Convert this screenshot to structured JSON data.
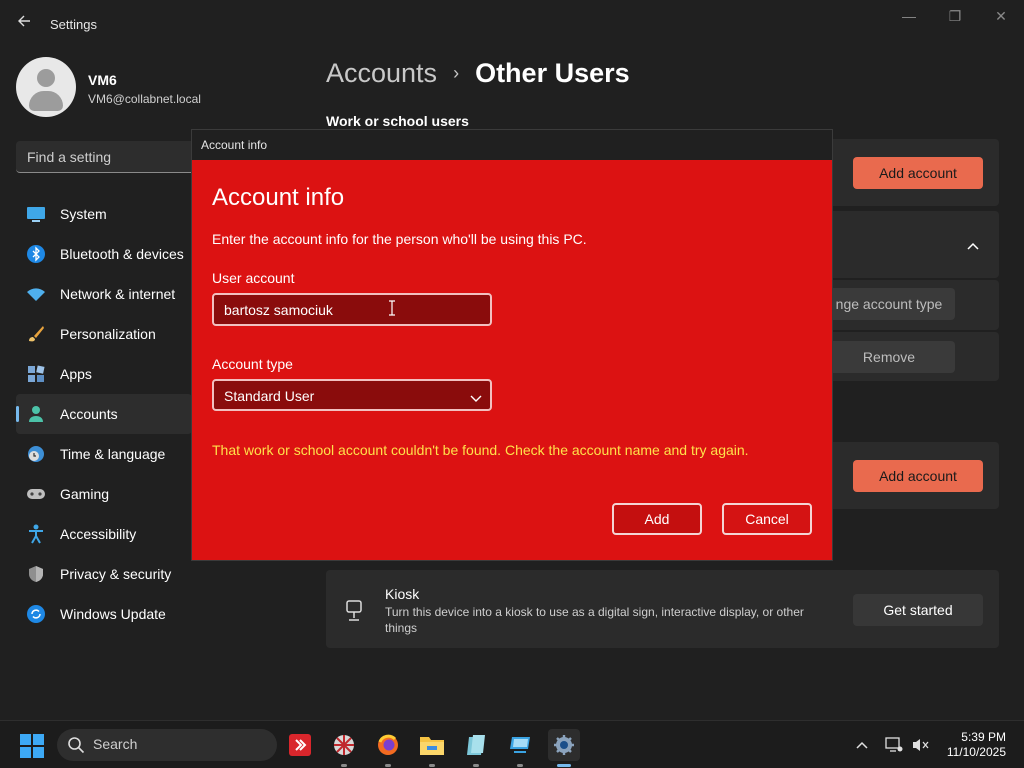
{
  "window": {
    "title": "Settings",
    "minimize_glyph": "—",
    "maximize_glyph": "❐",
    "close_glyph": "✕"
  },
  "profile": {
    "name": "VM6",
    "email": "VM6@collabnet.local"
  },
  "search": {
    "placeholder": "Find a setting"
  },
  "sidebar": {
    "items": [
      {
        "label": "System",
        "icon": "monitor-icon"
      },
      {
        "label": "Bluetooth & devices",
        "icon": "bluetooth-icon"
      },
      {
        "label": "Network & internet",
        "icon": "wifi-icon"
      },
      {
        "label": "Personalization",
        "icon": "brush-icon"
      },
      {
        "label": "Apps",
        "icon": "apps-icon"
      },
      {
        "label": "Accounts",
        "icon": "person-icon",
        "active": true
      },
      {
        "label": "Time & language",
        "icon": "globe-clock-icon"
      },
      {
        "label": "Gaming",
        "icon": "gamepad-icon"
      },
      {
        "label": "Accessibility",
        "icon": "accessibility-icon"
      },
      {
        "label": "Privacy & security",
        "icon": "shield-icon"
      },
      {
        "label": "Windows Update",
        "icon": "update-icon"
      }
    ]
  },
  "main": {
    "breadcrumb_parent": "Accounts",
    "breadcrumb_separator": "›",
    "breadcrumb_current": "Other Users",
    "work_section_title": "Work or school users",
    "add_account_label": "Add account",
    "change_account_type_label": "nge account type",
    "remove_label": "Remove",
    "add_account_label_2": "Add account",
    "kiosk": {
      "title": "Kiosk",
      "description": "Turn this device into a kiosk to use as a digital sign, interactive display, or other things",
      "button": "Get started"
    }
  },
  "dialog": {
    "bar_title": "Account info",
    "heading": "Account info",
    "description": "Enter the account info for the person who'll be using this PC.",
    "user_account_label": "User account",
    "user_account_value": "bartosz samociuk",
    "account_type_label": "Account type",
    "account_type_value": "Standard User",
    "error": "That work or school account couldn't be found. Check the account name and try again.",
    "add_button": "Add",
    "cancel_button": "Cancel"
  },
  "taskbar": {
    "search_placeholder": "Search",
    "clock_time": "5:39 PM",
    "clock_date": "11/10/2025"
  },
  "colors": {
    "dialog_background": "#dc1212",
    "error_text": "#ffe14a",
    "accent_button": "#e96a4e",
    "nav_indicator": "#76b9ed"
  }
}
